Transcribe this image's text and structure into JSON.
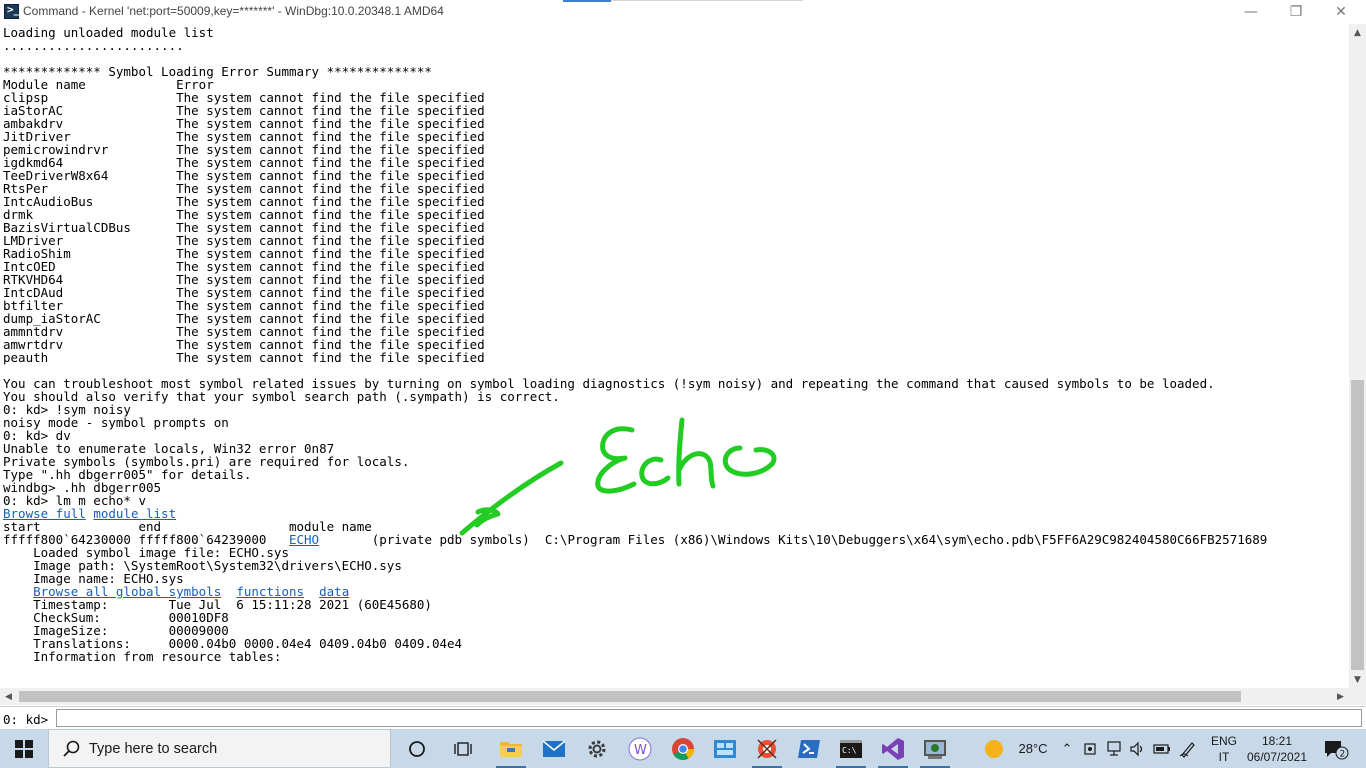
{
  "window": {
    "title": "Command - Kernel 'net:port=50009,key=*******' - WinDbg:10.0.20348.1 AMD64"
  },
  "output": {
    "lines": [
      {
        "text": "Loading unloaded module list"
      },
      {
        "text": "........................"
      },
      {
        "text": ""
      },
      {
        "text": "************* Symbol Loading Error Summary **************"
      },
      {
        "text": "Module name            Error"
      },
      {
        "text": "clipsp                 The system cannot find the file specified"
      },
      {
        "text": "iaStorAC               The system cannot find the file specified"
      },
      {
        "text": "ambakdrv               The system cannot find the file specified"
      },
      {
        "text": "JitDriver              The system cannot find the file specified"
      },
      {
        "text": "pemicrowindrvr         The system cannot find the file specified"
      },
      {
        "text": "igdkmd64               The system cannot find the file specified"
      },
      {
        "text": "TeeDriverW8x64         The system cannot find the file specified"
      },
      {
        "text": "RtsPer                 The system cannot find the file specified"
      },
      {
        "text": "IntcAudioBus           The system cannot find the file specified"
      },
      {
        "text": "drmk                   The system cannot find the file specified"
      },
      {
        "text": "BazisVirtualCDBus      The system cannot find the file specified"
      },
      {
        "text": "LMDriver               The system cannot find the file specified"
      },
      {
        "text": "RadioShim              The system cannot find the file specified"
      },
      {
        "text": "IntcOED                The system cannot find the file specified"
      },
      {
        "text": "RTKVHD64               The system cannot find the file specified"
      },
      {
        "text": "IntcDAud               The system cannot find the file specified"
      },
      {
        "text": "btfilter               The system cannot find the file specified"
      },
      {
        "text": "dump_iaStorAC          The system cannot find the file specified"
      },
      {
        "text": "ammntdrv               The system cannot find the file specified"
      },
      {
        "text": "amwrtdrv               The system cannot find the file specified"
      },
      {
        "text": "peauth                 The system cannot find the file specified"
      },
      {
        "text": ""
      },
      {
        "text": "You can troubleshoot most symbol related issues by turning on symbol loading diagnostics (!sym noisy) and repeating the command that caused symbols to be loaded."
      },
      {
        "text": "You should also verify that your symbol search path (.sympath) is correct."
      },
      {
        "text": "0: kd> !sym noisy"
      },
      {
        "text": "noisy mode - symbol prompts on"
      },
      {
        "text": "0: kd> dv"
      },
      {
        "text": "Unable to enumerate locals, Win32 error 0n87"
      },
      {
        "text": "Private symbols (symbols.pri) are required for locals."
      },
      {
        "text": "Type \".hh dbgerr005\" for details."
      },
      {
        "text": "windbg> .hh dbgerr005"
      },
      {
        "text": "0: kd> lm m echo* v"
      },
      {
        "segs": [
          {
            "t": "Browse full",
            "link": true
          },
          {
            "t": " "
          },
          {
            "t": "module list",
            "link": true
          }
        ]
      },
      {
        "text": "start             end                 module name"
      },
      {
        "segs": [
          {
            "t": "fffff800`64230000 fffff800`64239000   "
          },
          {
            "t": "ECHO",
            "link": true
          },
          {
            "t": "       (private pdb symbols)  C:\\Program Files (x86)\\Windows Kits\\10\\Debuggers\\x64\\sym\\echo.pdb\\F5FF6A29C982404580C66FB2571689"
          }
        ]
      },
      {
        "text": "    Loaded symbol image file: ECHO.sys"
      },
      {
        "text": "    Image path: \\SystemRoot\\System32\\drivers\\ECHO.sys"
      },
      {
        "text": "    Image name: ECHO.sys"
      },
      {
        "segs": [
          {
            "t": "    "
          },
          {
            "t": "Browse all global symbols",
            "link": true
          },
          {
            "t": "  "
          },
          {
            "t": "functions",
            "link": true
          },
          {
            "t": "  "
          },
          {
            "t": "data",
            "link": true
          }
        ]
      },
      {
        "text": "    Timestamp:        Tue Jul  6 15:11:28 2021 (60E45680)"
      },
      {
        "text": "    CheckSum:         00010DF8"
      },
      {
        "text": "    ImageSize:        00009000"
      },
      {
        "text": "    Translations:     0000.04b0 0000.04e4 0409.04b0 0409.04e4"
      },
      {
        "text": "    Information from resource tables:"
      }
    ]
  },
  "annotation": {
    "text": "Echo",
    "color": "#22cc22"
  },
  "command": {
    "prompt": "0: kd>",
    "value": ""
  },
  "taskbar": {
    "search_placeholder": "Type here to search",
    "apps": [
      "task-view-icon",
      "taskbar-multitasking-icon",
      "file-explorer-icon",
      "mail-icon",
      "settings-icon",
      "word-app-icon",
      "chrome-icon",
      "photos-app-icon",
      "windbg-icon",
      "powershell-icon",
      "command-prompt-icon",
      "visual-studio-icon",
      "windbg-preview-icon"
    ],
    "weather": "28°C",
    "language_top": "ENG",
    "language_bottom": "IT",
    "time": "18:21",
    "date": "06/07/2021",
    "notification_count": "2"
  }
}
